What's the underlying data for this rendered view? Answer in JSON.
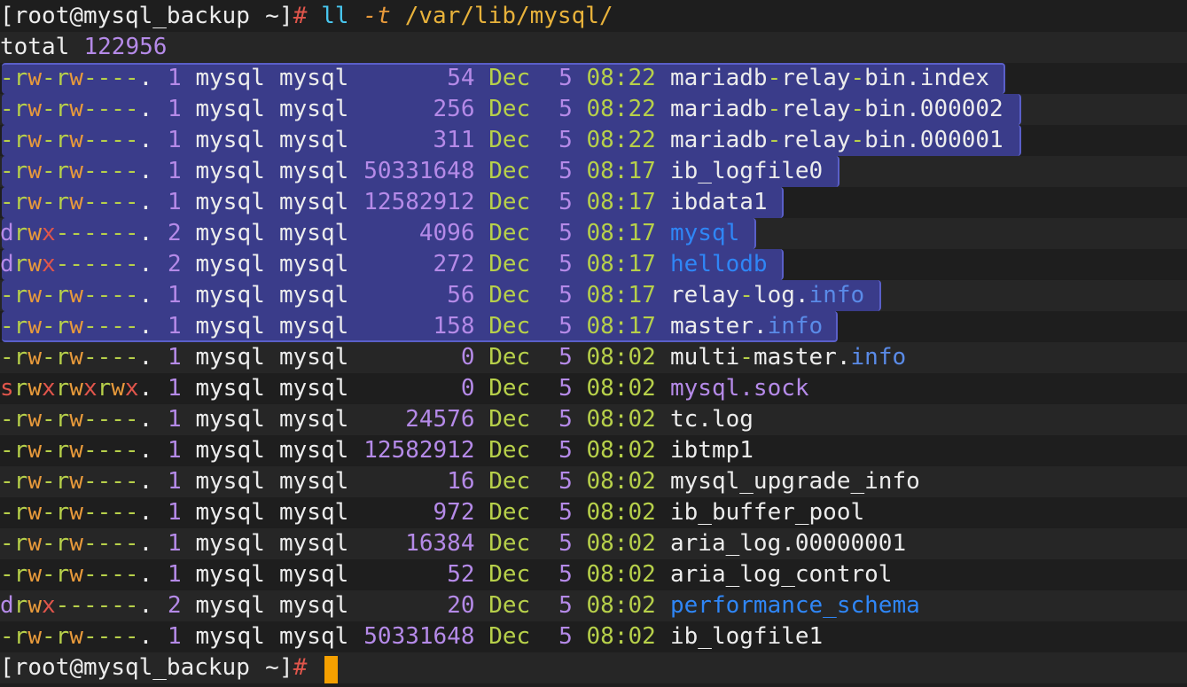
{
  "prompt": {
    "open": "[",
    "user_host": "root@mysql_backup",
    "dir": " ~",
    "close": "]",
    "hash": "#"
  },
  "command": {
    "name": "ll",
    "flag": "-t",
    "path": "/var/lib/mysql/"
  },
  "total": {
    "label": "total",
    "value": "122956"
  },
  "files": [
    {
      "perm": "-rw-rw----.",
      "links": "1",
      "user": "mysql",
      "group": "mysql",
      "size": "54",
      "month": "Dec",
      "day": "5",
      "time": "08:22",
      "name": "mariadb-relay-bin.index",
      "type": "file",
      "selected": true
    },
    {
      "perm": "-rw-rw----.",
      "links": "1",
      "user": "mysql",
      "group": "mysql",
      "size": "256",
      "month": "Dec",
      "day": "5",
      "time": "08:22",
      "name": "mariadb-relay-bin.000002",
      "type": "file",
      "selected": true
    },
    {
      "perm": "-rw-rw----.",
      "links": "1",
      "user": "mysql",
      "group": "mysql",
      "size": "311",
      "month": "Dec",
      "day": "5",
      "time": "08:22",
      "name": "mariadb-relay-bin.000001",
      "type": "file",
      "selected": true
    },
    {
      "perm": "-rw-rw----.",
      "links": "1",
      "user": "mysql",
      "group": "mysql",
      "size": "50331648",
      "month": "Dec",
      "day": "5",
      "time": "08:17",
      "name": "ib_logfile0",
      "type": "file",
      "selected": true
    },
    {
      "perm": "-rw-rw----.",
      "links": "1",
      "user": "mysql",
      "group": "mysql",
      "size": "12582912",
      "month": "Dec",
      "day": "5",
      "time": "08:17",
      "name": "ibdata1",
      "type": "file",
      "selected": true
    },
    {
      "perm": "drwx------.",
      "links": "2",
      "user": "mysql",
      "group": "mysql",
      "size": "4096",
      "month": "Dec",
      "day": "5",
      "time": "08:17",
      "name": "mysql",
      "type": "dir",
      "selected": true
    },
    {
      "perm": "drwx------.",
      "links": "2",
      "user": "mysql",
      "group": "mysql",
      "size": "272",
      "month": "Dec",
      "day": "5",
      "time": "08:17",
      "name": "hellodb",
      "type": "dir",
      "selected": true
    },
    {
      "perm": "-rw-rw----.",
      "links": "1",
      "user": "mysql",
      "group": "mysql",
      "size": "56",
      "month": "Dec",
      "day": "5",
      "time": "08:17",
      "name": "relay-log.info",
      "type": "file",
      "selected": true
    },
    {
      "perm": "-rw-rw----.",
      "links": "1",
      "user": "mysql",
      "group": "mysql",
      "size": "158",
      "month": "Dec",
      "day": "5",
      "time": "08:17",
      "name": "master.info",
      "type": "file",
      "selected": true
    },
    {
      "perm": "-rw-rw----.",
      "links": "1",
      "user": "mysql",
      "group": "mysql",
      "size": "0",
      "month": "Dec",
      "day": "5",
      "time": "08:02",
      "name": "multi-master.info",
      "type": "file",
      "selected": false
    },
    {
      "perm": "srwxrwxrwx.",
      "links": "1",
      "user": "mysql",
      "group": "mysql",
      "size": "0",
      "month": "Dec",
      "day": "5",
      "time": "08:02",
      "name": "mysql.sock",
      "type": "sock",
      "selected": false
    },
    {
      "perm": "-rw-rw----.",
      "links": "1",
      "user": "mysql",
      "group": "mysql",
      "size": "24576",
      "month": "Dec",
      "day": "5",
      "time": "08:02",
      "name": "tc.log",
      "type": "file",
      "selected": false
    },
    {
      "perm": "-rw-rw----.",
      "links": "1",
      "user": "mysql",
      "group": "mysql",
      "size": "12582912",
      "month": "Dec",
      "day": "5",
      "time": "08:02",
      "name": "ibtmp1",
      "type": "file",
      "selected": false
    },
    {
      "perm": "-rw-rw----.",
      "links": "1",
      "user": "mysql",
      "group": "mysql",
      "size": "16",
      "month": "Dec",
      "day": "5",
      "time": "08:02",
      "name": "mysql_upgrade_info",
      "type": "file",
      "selected": false
    },
    {
      "perm": "-rw-rw----.",
      "links": "1",
      "user": "mysql",
      "group": "mysql",
      "size": "972",
      "month": "Dec",
      "day": "5",
      "time": "08:02",
      "name": "ib_buffer_pool",
      "type": "file",
      "selected": false
    },
    {
      "perm": "-rw-rw----.",
      "links": "1",
      "user": "mysql",
      "group": "mysql",
      "size": "16384",
      "month": "Dec",
      "day": "5",
      "time": "08:02",
      "name": "aria_log.00000001",
      "type": "file",
      "selected": false
    },
    {
      "perm": "-rw-rw----.",
      "links": "1",
      "user": "mysql",
      "group": "mysql",
      "size": "52",
      "month": "Dec",
      "day": "5",
      "time": "08:02",
      "name": "aria_log_control",
      "type": "file",
      "selected": false
    },
    {
      "perm": "drwx------.",
      "links": "2",
      "user": "mysql",
      "group": "mysql",
      "size": "20",
      "month": "Dec",
      "day": "5",
      "time": "08:02",
      "name": "performance_schema",
      "type": "dir",
      "selected": false
    },
    {
      "perm": "-rw-rw----.",
      "links": "1",
      "user": "mysql",
      "group": "mysql",
      "size": "50331648",
      "month": "Dec",
      "day": "5",
      "time": "08:02",
      "name": "ib_logfile1",
      "type": "file",
      "selected": false
    }
  ],
  "colors": {
    "background": "#1e1e1e",
    "selection": "#3a3c8a",
    "cursor": "#f5a000",
    "directory": "#2f86f6",
    "socket": "#b58ae8"
  }
}
